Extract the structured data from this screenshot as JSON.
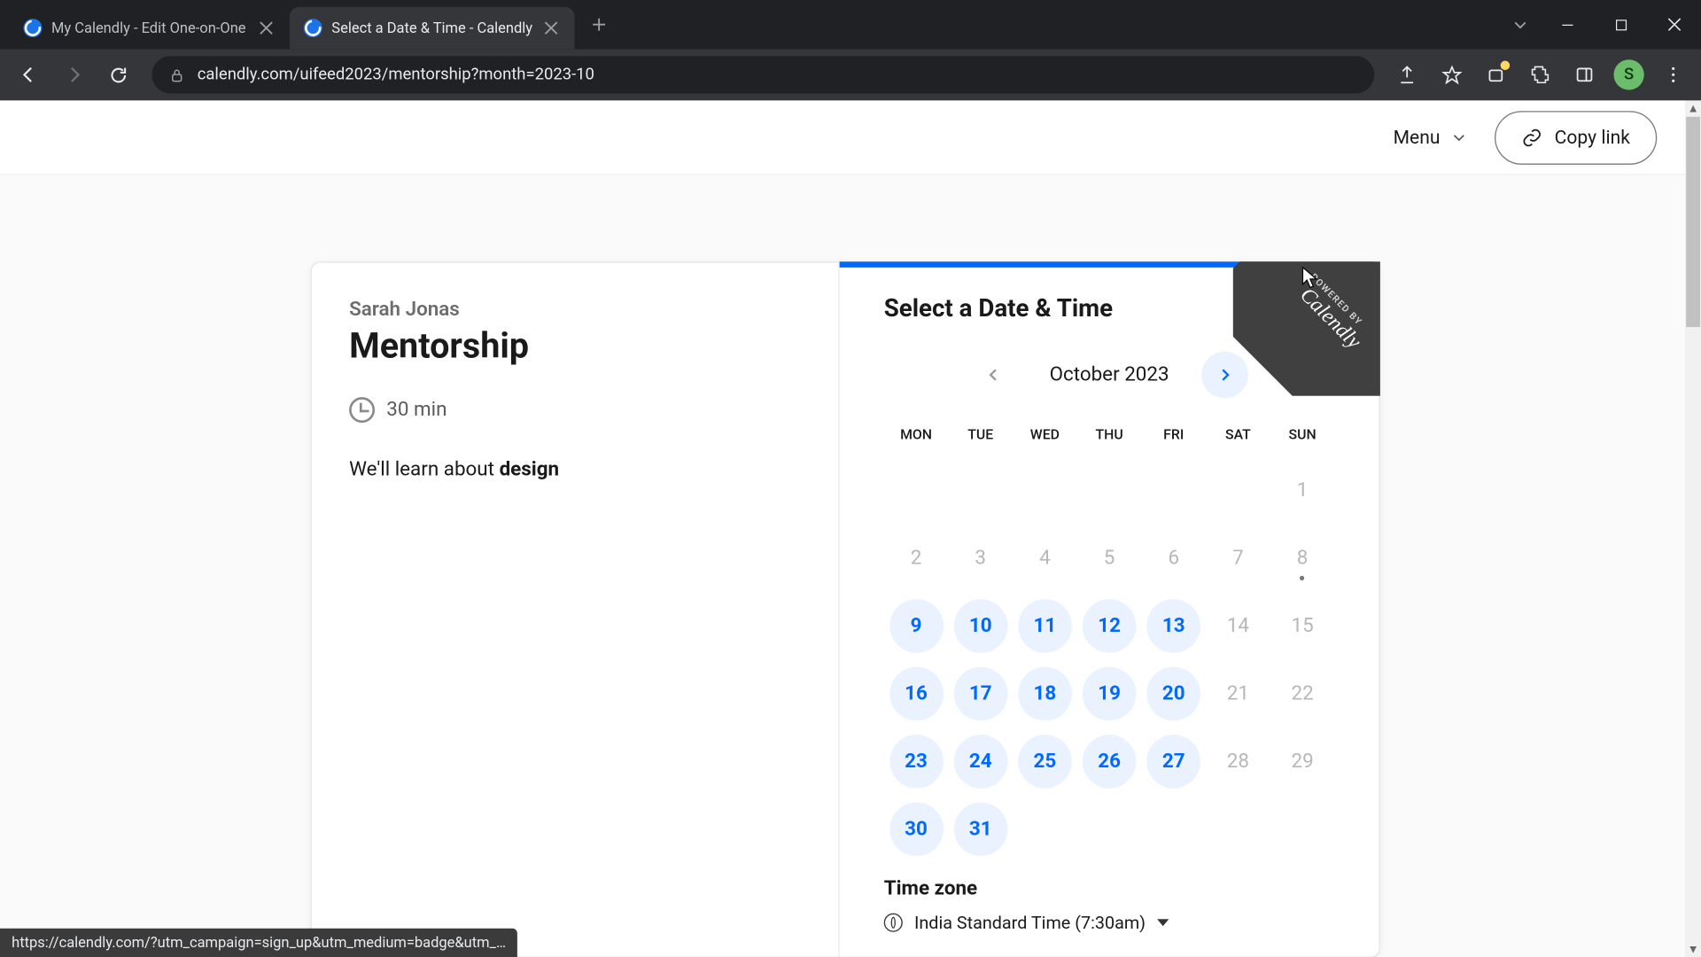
{
  "browser": {
    "tabs": [
      {
        "title": "My Calendly - Edit One-on-One",
        "active": false
      },
      {
        "title": "Select a Date & Time - Calendly",
        "active": true
      }
    ],
    "url": "calendly.com/uifeed2023/mentorship?month=2023-10",
    "profile_initial": "S",
    "status_bar": "https://calendly.com/?utm_campaign=sign_up&utm_medium=badge&utm_…"
  },
  "topbar": {
    "menu_label": "Menu",
    "copy_link_label": "Copy link"
  },
  "event": {
    "host": "Sarah Jonas",
    "title": "Mentorship",
    "duration": "30 min",
    "description_prefix": "We'll learn about ",
    "description_bold": "design"
  },
  "scheduler": {
    "heading": "Select a Date & Time",
    "ribbon_small": "POWERED BY",
    "ribbon_brand": "Calendly",
    "month_label": "October 2023",
    "dow": [
      "MON",
      "TUE",
      "WED",
      "THU",
      "FRI",
      "SAT",
      "SUN"
    ],
    "weeks": [
      [
        {
          "d": "",
          "s": "blank"
        },
        {
          "d": "",
          "s": "blank"
        },
        {
          "d": "",
          "s": "blank"
        },
        {
          "d": "",
          "s": "blank"
        },
        {
          "d": "",
          "s": "blank"
        },
        {
          "d": "",
          "s": "blank"
        },
        {
          "d": "1",
          "s": "disabled"
        }
      ],
      [
        {
          "d": "2",
          "s": "disabled"
        },
        {
          "d": "3",
          "s": "disabled"
        },
        {
          "d": "4",
          "s": "disabled"
        },
        {
          "d": "5",
          "s": "disabled"
        },
        {
          "d": "6",
          "s": "disabled"
        },
        {
          "d": "7",
          "s": "disabled"
        },
        {
          "d": "8",
          "s": "disabled today"
        }
      ],
      [
        {
          "d": "9",
          "s": "avail"
        },
        {
          "d": "10",
          "s": "avail"
        },
        {
          "d": "11",
          "s": "avail"
        },
        {
          "d": "12",
          "s": "avail"
        },
        {
          "d": "13",
          "s": "avail"
        },
        {
          "d": "14",
          "s": "disabled"
        },
        {
          "d": "15",
          "s": "disabled"
        }
      ],
      [
        {
          "d": "16",
          "s": "avail"
        },
        {
          "d": "17",
          "s": "avail"
        },
        {
          "d": "18",
          "s": "avail"
        },
        {
          "d": "19",
          "s": "avail"
        },
        {
          "d": "20",
          "s": "avail"
        },
        {
          "d": "21",
          "s": "disabled"
        },
        {
          "d": "22",
          "s": "disabled"
        }
      ],
      [
        {
          "d": "23",
          "s": "avail"
        },
        {
          "d": "24",
          "s": "avail"
        },
        {
          "d": "25",
          "s": "avail"
        },
        {
          "d": "26",
          "s": "avail"
        },
        {
          "d": "27",
          "s": "avail"
        },
        {
          "d": "28",
          "s": "disabled"
        },
        {
          "d": "29",
          "s": "disabled"
        }
      ],
      [
        {
          "d": "30",
          "s": "avail"
        },
        {
          "d": "31",
          "s": "avail"
        },
        {
          "d": "",
          "s": "blank"
        },
        {
          "d": "",
          "s": "blank"
        },
        {
          "d": "",
          "s": "blank"
        },
        {
          "d": "",
          "s": "blank"
        },
        {
          "d": "",
          "s": "blank"
        }
      ]
    ],
    "tz_heading": "Time zone",
    "tz_value": "India Standard Time (7:30am)"
  }
}
